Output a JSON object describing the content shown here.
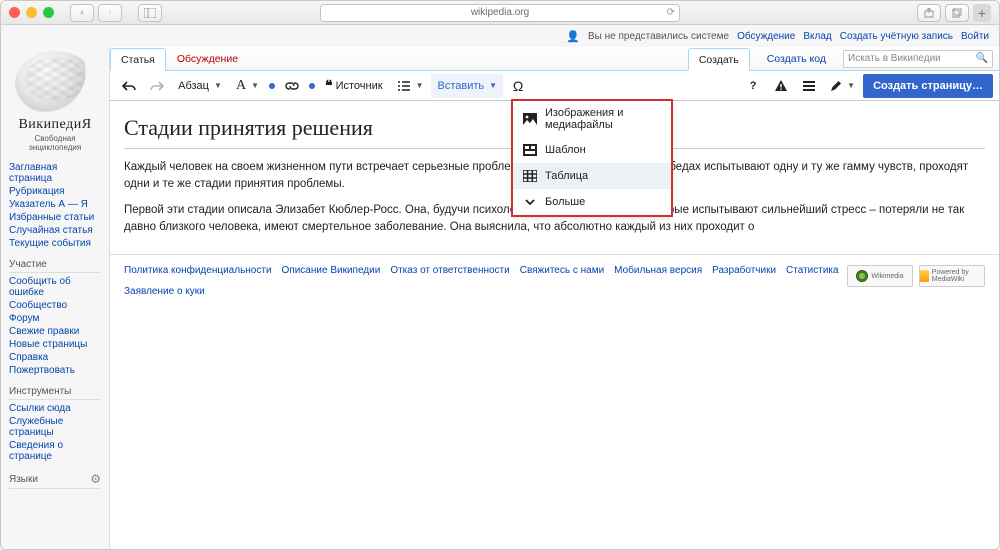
{
  "browser": {
    "address": "wikipedia.org"
  },
  "topmeta": {
    "not_logged": "Вы не представились системе",
    "discussion": "Обсуждение",
    "contribs": "Вклад",
    "create_account": "Создать учётную запись",
    "login": "Войти"
  },
  "logo": {
    "wordmark": "ВикипедиЯ",
    "tagline": "Свободная энциклопедия"
  },
  "sidebar": {
    "nav": [
      "Заглавная страница",
      "Рубрикация",
      "Указатель А — Я",
      "Избранные статьи",
      "Случайная статья",
      "Текущие события"
    ],
    "part_head": "Участие",
    "part": [
      "Сообщить об ошибке",
      "Сообщество",
      "Форум",
      "Свежие правки",
      "Новые страницы",
      "Справка",
      "Пожертвовать"
    ],
    "tools_head": "Инструменты",
    "tools": [
      "Ссылки сюда",
      "Служебные страницы",
      "Сведения о странице"
    ],
    "lang_head": "Языки"
  },
  "tabs": {
    "article": "Статья",
    "discussion": "Обсуждение",
    "create": "Создать",
    "create_code": "Создать код"
  },
  "search": {
    "placeholder": "Искать в Википедии"
  },
  "toolbar": {
    "paragraph": "Абзац",
    "format_letter": "A",
    "source": "Источник",
    "insert": "Вставить",
    "omega": "Ω",
    "publish": "Создать страницу…"
  },
  "dropdown": {
    "media": "Изображения и медиафайлы",
    "template": "Шаблон",
    "table": "Таблица",
    "more": "Больше"
  },
  "article": {
    "title": "Стадии принятия решения",
    "p1": "Каждый человек на своем жизненном пути встречает серьезные проблемы. Все люди при серьезных бедах испытывают одну и ту же гамму чувств, проходят одни и те же стадии принятия проблемы.",
    "p2": "Первой эти стадии описала Элизабет Кюблер-Росс. Она, будучи психологом, наблюдала людей, которые испытывают сильнейший стресс – потеряли не так давно близкого человека, имеют смертельное заболевание. Она выяснила, что абсолютно каждый из них проходит о"
  },
  "footer": {
    "links": [
      "Политика конфиденциальности",
      "Описание Википедии",
      "Отказ от ответственности",
      "Свяжитесь с нами",
      "Мобильная версия",
      "Разработчики",
      "Статистика",
      "Заявление о куки"
    ],
    "badge1": "Wikimedia",
    "badge2": "Powered by MediaWiki"
  }
}
